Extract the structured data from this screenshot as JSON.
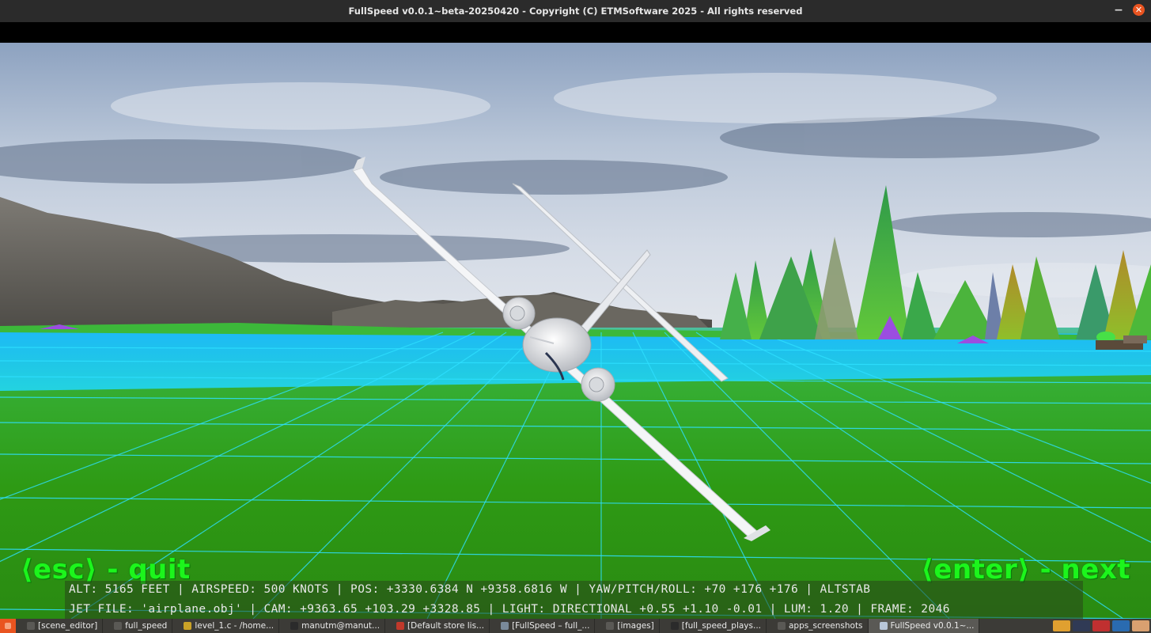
{
  "window": {
    "title": "FullSpeed v0.0.1~beta-20250420 - Copyright (C) ETMSoftware 2025 - All rights reserved",
    "minimize_glyph": "−",
    "close_glyph": "✕"
  },
  "hud": {
    "quit_prompt": "⟨esc⟩ - quit",
    "next_prompt": "⟨enter⟩ - next",
    "status_line": "ALT: 5165 FEET | AIRSPEED: 500 KNOTS | POS: +3330.6384 N +9358.6816 W | YAW/PITCH/ROLL: +70 +176 +176 | ALTSTAB",
    "info_line": "JET FILE: 'airplane.obj' | CAM: +9363.65 +103.29 +3328.85 | LIGHT: DIRECTIONAL +0.55 +1.10 -0.01 | LUM: 1.20 | FRAME: 2046"
  },
  "taskbar": {
    "items": [
      {
        "label": "[scene_editor]",
        "icon_color": "#5a5955"
      },
      {
        "label": "full_speed",
        "icon_color": "#5a5955"
      },
      {
        "label": "level_1.c - /home...",
        "icon_color": "#c9a227"
      },
      {
        "label": "manutm@manut...",
        "icon_color": "#2b2b2b"
      },
      {
        "label": "[Default store lis...",
        "icon_color": "#c0392b"
      },
      {
        "label": "[FullSpeed – full_...",
        "icon_color": "#7a8a9a"
      },
      {
        "label": "[images]",
        "icon_color": "#5a5955"
      },
      {
        "label": "[full_speed_plays...",
        "icon_color": "#2b2b2b"
      },
      {
        "label": "apps_screenshots",
        "icon_color": "#5a5955"
      },
      {
        "label": "FullSpeed v0.0.1~...",
        "icon_color": "#b8c6d8",
        "active": true
      }
    ],
    "tray_colors": [
      "#e0a030",
      "#303a55",
      "#c03030",
      "#2a6bb0",
      "#d9a070"
    ]
  },
  "colors": {
    "hud_green": "#1cf51c",
    "grid_cyan": "#2ee0ff",
    "ground_green": "#2f9a10",
    "water_cyan": "#1ec8ff"
  }
}
